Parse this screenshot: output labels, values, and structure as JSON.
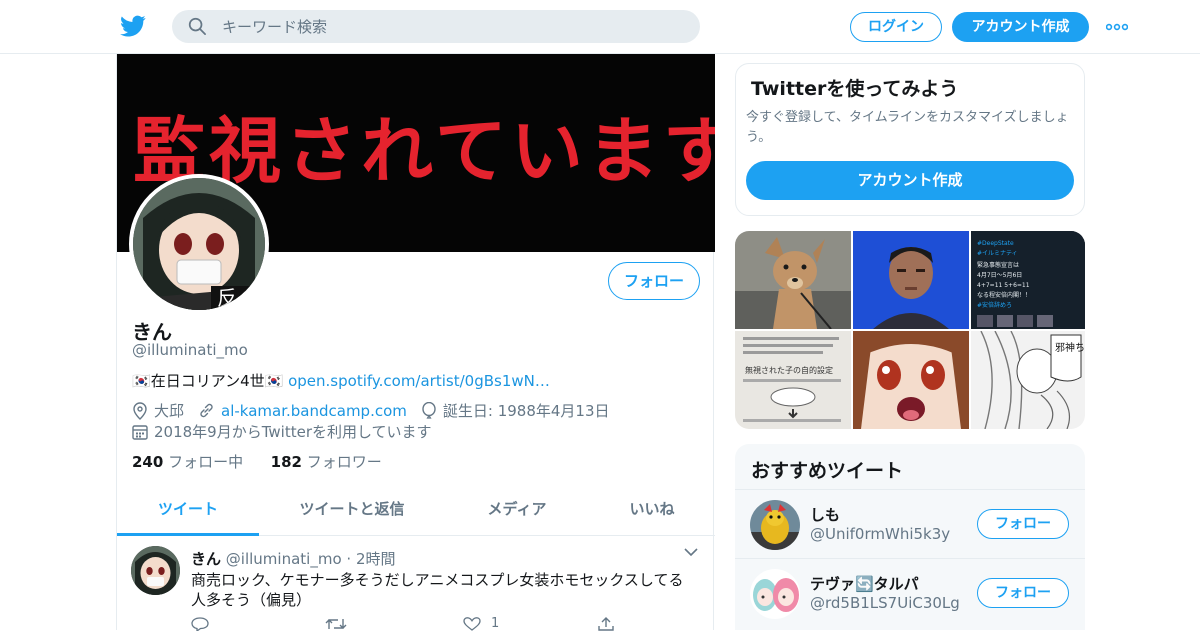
{
  "header": {
    "search_placeholder": "キーワード検索",
    "login_label": "ログイン",
    "signup_label": "アカウント作成"
  },
  "profile": {
    "banner_text": "監視されています！",
    "avatar_overlay_text": "反",
    "follow_label": "フォロー",
    "name": "きん",
    "handle": "@illuminati_mo",
    "bio_flag_left": "🇰🇷",
    "bio_text": "在日コリアン4世",
    "bio_flag_right": "🇰🇷",
    "bio_link": "open.spotify.com/artist/0gBs1wN…",
    "location": "大邱",
    "website": "al-kamar.bandcamp.com",
    "birthday": "誕生日: 1988年4月13日",
    "joined": "2018年9月からTwitterを利用しています",
    "following_count": "240",
    "following_label": "フォロー中",
    "followers_count": "182",
    "followers_label": "フォロワー"
  },
  "tabs": [
    "ツイート",
    "ツイートと返信",
    "メディア",
    "いいね"
  ],
  "tweet": {
    "name": "きん",
    "handle": "@illuminati_mo",
    "separator": "·",
    "time": "2時間",
    "text": "商売ロック、ケモナー多そうだしアニメコスプレ女装ホモセックスしてる人多そう（偏見）",
    "like_count": "1"
  },
  "signup_card": {
    "title": "Twitterを使ってみよう",
    "subtitle": "今すぐ登録して、タイムラインをカスタマイズしましょう。",
    "button_label": "アカウント作成"
  },
  "media_grid": {
    "tile3_lines": [
      "#DeepState",
      "#イルミナティ",
      "緊急事態宣言は",
      "4月7日〜5月6日",
      "4+7=11 5+6=11",
      "なる程安倍内閣！！",
      "#安倍辞めろ"
    ],
    "tile4_caption": "無視された子の自的設定",
    "tile6_text": "邪神ちゃんですの"
  },
  "recommended": {
    "title": "おすすめツイート",
    "users": [
      {
        "name": "しも",
        "handle": "@Unif0rmWhi5k3y",
        "follow_label": "フォロー"
      },
      {
        "name": "テヴァ🔄タルパ",
        "handle": "@rd5B1LS7UiC30Lg",
        "follow_label": "フォロー"
      }
    ]
  },
  "colors": {
    "accent": "#1da1f2",
    "text": "#14171a",
    "muted": "#657786",
    "banner_text": "#e5232e"
  }
}
